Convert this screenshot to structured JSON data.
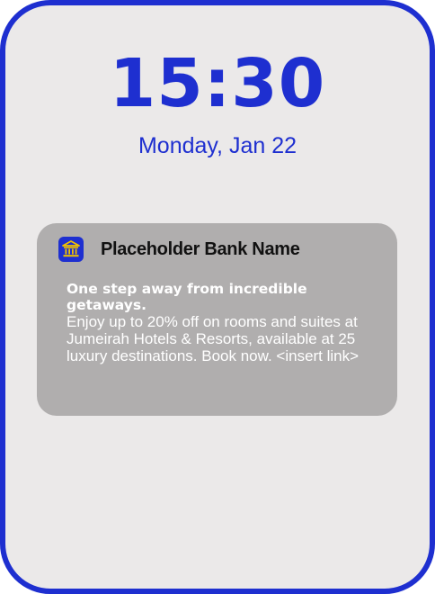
{
  "lock_screen": {
    "time": "15:30",
    "date": "Monday, Jan 22"
  },
  "notification": {
    "app_icon": "bank-building-icon",
    "app_name": "Placeholder Bank Name",
    "title": "One step away from incredible getaways.",
    "body": "Enjoy up to 20% off on rooms and suites at Jumeirah Hotels & Resorts, available at 25 luxury destinations. Book now. <insert link>"
  },
  "colors": {
    "accent": "#1e2fd0",
    "screen_background": "#ebe9e9",
    "notification_background": "#b0aeae",
    "icon_symbol": "#f2c200"
  }
}
